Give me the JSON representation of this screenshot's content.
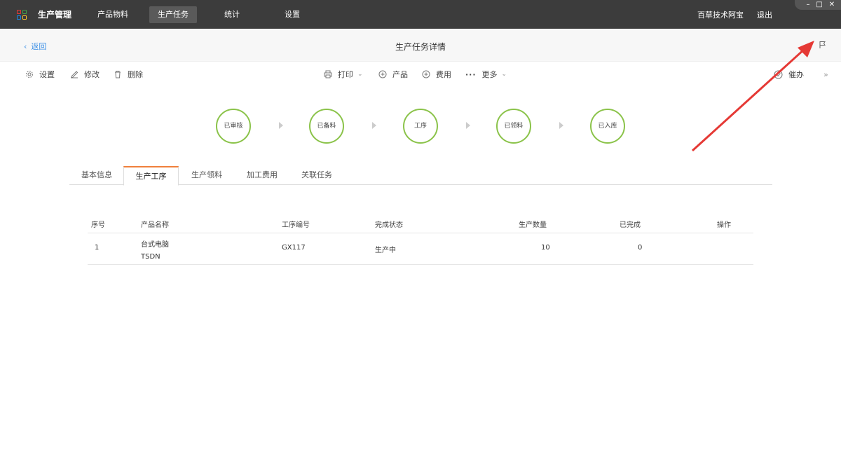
{
  "topbar": {
    "app_title": "生产管理",
    "nav": [
      "产品物料",
      "生产任务",
      "统计",
      "设置"
    ],
    "active_nav": "生产任务",
    "user": "百草技术阿宝",
    "logout": "退出",
    "window_controls": [
      "minimize-icon",
      "maximize-icon",
      "close-icon"
    ]
  },
  "header": {
    "back": "返回",
    "title": "生产任务详情",
    "right_icon": "flag-icon"
  },
  "toolbar": {
    "settings": "设置",
    "edit": "修改",
    "delete": "删除",
    "print": "打印",
    "product": "产品",
    "fee": "费用",
    "more": "更多",
    "handle": "催办"
  },
  "steps": [
    "已审核",
    "已备料",
    "工序",
    "已领料",
    "已入库"
  ],
  "tabs": [
    "基本信息",
    "生产工序",
    "生产领料",
    "加工费用",
    "关联任务"
  ],
  "active_tab": "生产工序",
  "table": {
    "headers": {
      "index": "序号",
      "product_name": "产品名称",
      "process_no": "工序编号",
      "status": "完成状态",
      "quantity": "生产数量",
      "completed": "已完成",
      "actions": "操作"
    },
    "rows": [
      {
        "index": "1",
        "product_name": "台式电脑",
        "product_code": "TSDN",
        "process_no": "GX117",
        "status": "生产中",
        "quantity": "10",
        "completed": "0"
      }
    ]
  },
  "colors": {
    "topbar_bg": "#3c3c3c",
    "accent_link": "#3a8ee6",
    "step_border": "#8bc34a",
    "active_tab_top": "#f0803c",
    "annotation_arrow": "#e53935"
  }
}
